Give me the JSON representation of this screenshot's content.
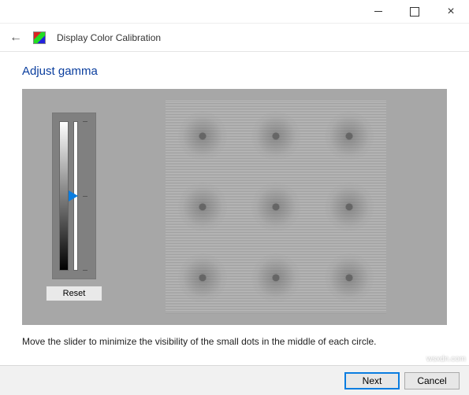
{
  "window": {
    "title": "Display Color Calibration"
  },
  "page": {
    "heading": "Adjust gamma",
    "instruction": "Move the slider to minimize the visibility of the small dots in the middle of each circle."
  },
  "controls": {
    "reset_label": "Reset",
    "next_label": "Next",
    "cancel_label": "Cancel"
  },
  "slider": {
    "min": 0,
    "max": 100,
    "value": 50
  },
  "icons": {
    "minimize": "minimize-icon",
    "maximize": "maximize-icon",
    "close": "close-icon",
    "back": "back-icon",
    "app": "display-calibration-icon"
  },
  "watermark": "wsxdn.com"
}
